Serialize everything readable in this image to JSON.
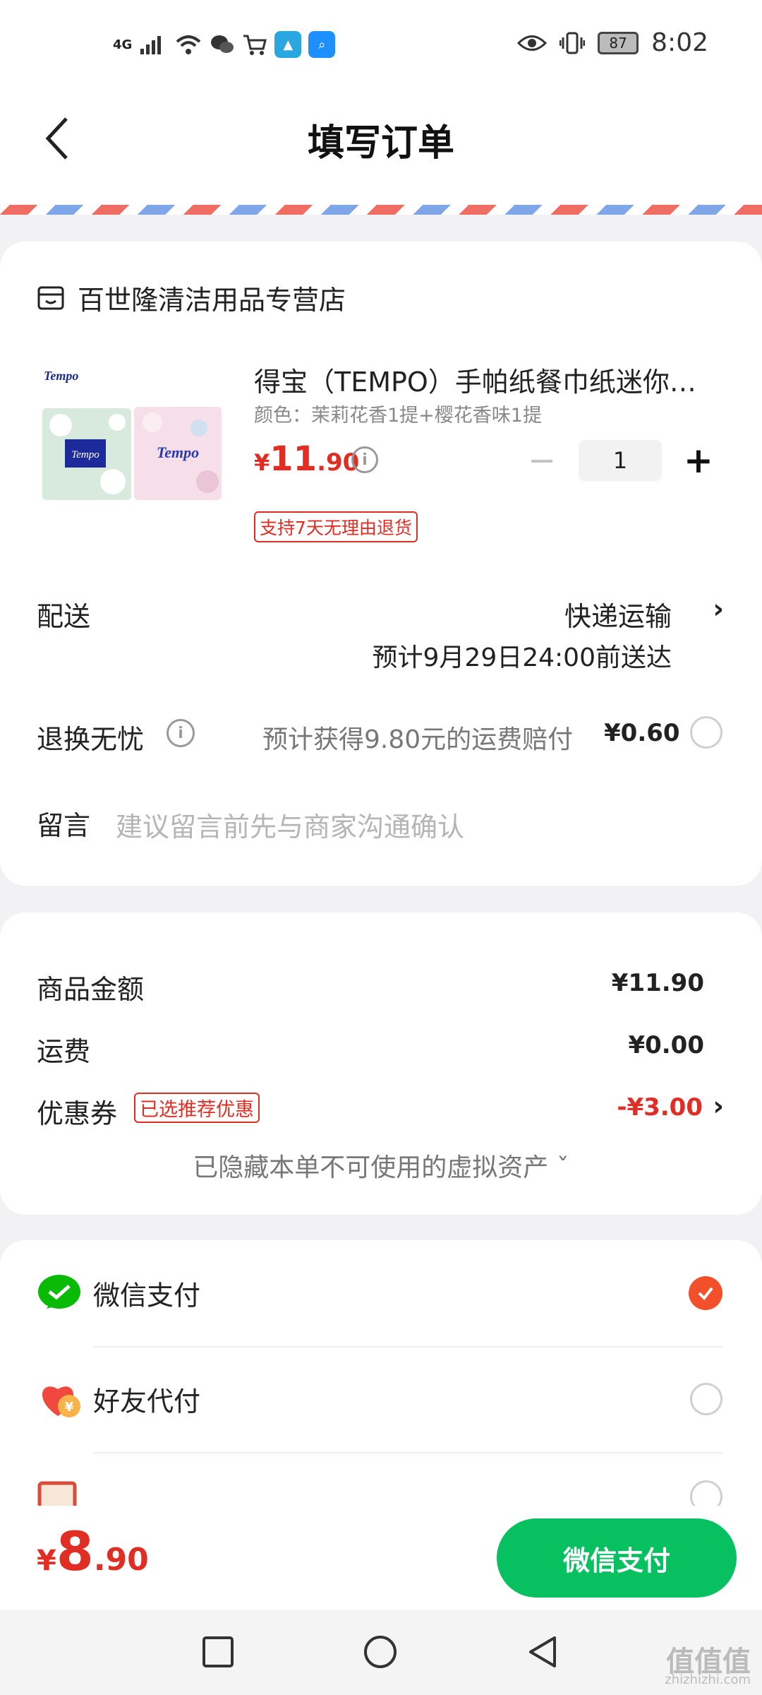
{
  "status_bar": {
    "time": "8:02",
    "battery": "87",
    "network": "4G"
  },
  "header": {
    "title": "填写订单"
  },
  "store": {
    "name": "百世隆清洁用品专营店"
  },
  "product": {
    "title": "得宝（TEMPO）手帕纸餐巾纸迷你…",
    "spec": "颜色：茉莉花香1提+樱花香味1提",
    "price_symbol": "¥",
    "price_int": "11",
    "price_dec": ".90",
    "quantity": "1",
    "return_badge": "支持7天无理由退货",
    "image_brand": "Tempo"
  },
  "delivery": {
    "label": "配送",
    "method": "快递运输",
    "eta": "预计9月29日24:00前送达"
  },
  "return_insurance": {
    "label": "退换无忧",
    "desc": "预计获得9.80元的运费赔付",
    "price": "¥0.60"
  },
  "message": {
    "label": "留言",
    "placeholder": "建议留言前先与商家沟通确认"
  },
  "summary": {
    "goods_label": "商品金额",
    "goods_value": "¥11.90",
    "shipping_label": "运费",
    "shipping_value": "¥0.00",
    "coupon_label": "优惠券",
    "coupon_badge": "已选推荐优惠",
    "coupon_value": "-¥3.00",
    "hidden_assets": "已隐藏本单不可使用的虚拟资产 ˇ"
  },
  "payment": {
    "options": [
      {
        "label": "微信支付",
        "selected": true
      },
      {
        "label": "好友代付",
        "selected": false
      },
      {
        "label": "",
        "selected": false
      }
    ]
  },
  "bottom": {
    "total_symbol": "¥",
    "total_int": "8",
    "total_dec": ".90",
    "pay_button": "微信支付"
  },
  "watermark": {
    "text": "值值值",
    "url": "zhizhizhi.com"
  },
  "colors": {
    "accent_red": "#e02e24",
    "wechat_green": "#07c160",
    "check_orange": "#f2502a"
  }
}
